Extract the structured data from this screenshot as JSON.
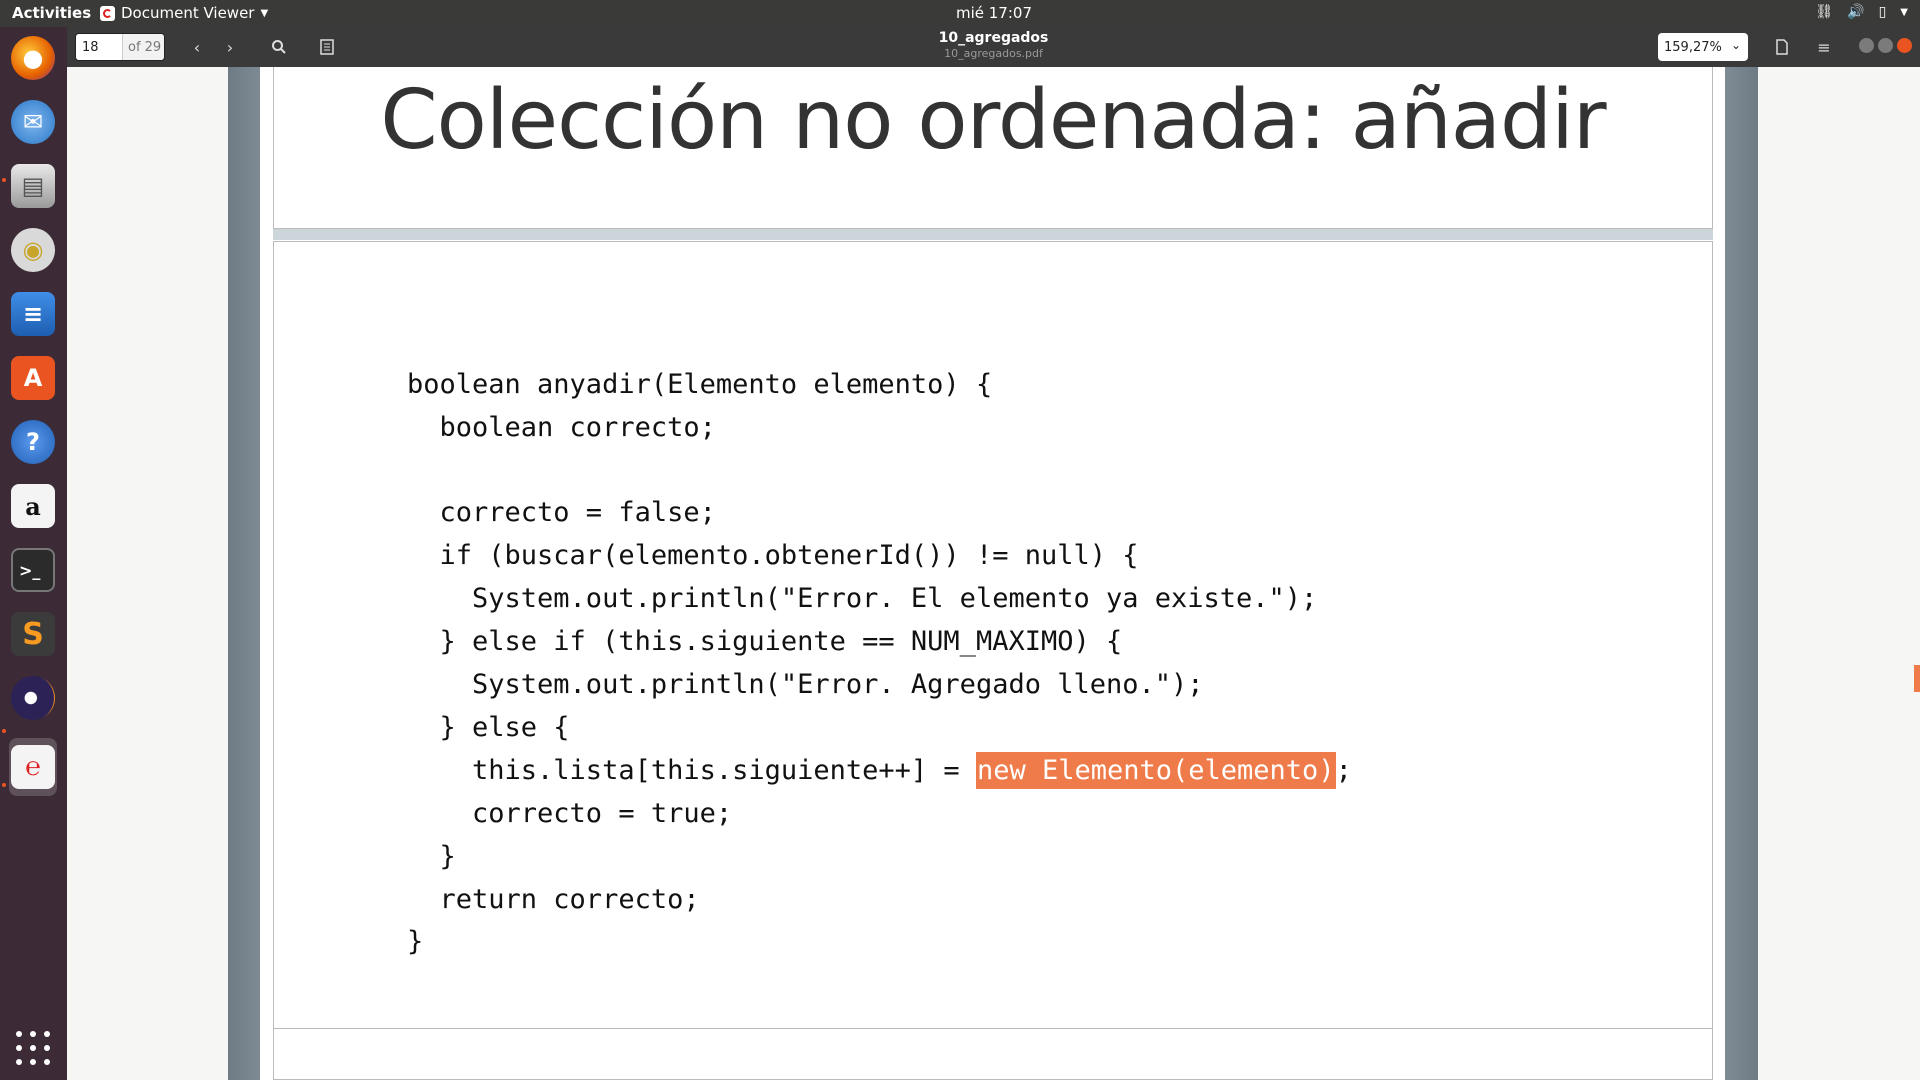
{
  "topbar": {
    "activities": "Activities",
    "app_name": "Document Viewer",
    "clock": "mié 17:07"
  },
  "dock": {
    "apps": [
      {
        "name": "firefox-icon",
        "color": "#e66000"
      },
      {
        "name": "thunderbird-icon",
        "color": "#2a78c8"
      },
      {
        "name": "files-icon",
        "color": "#8a8a8a"
      },
      {
        "name": "rhythmbox-icon",
        "color": "#c8a428"
      },
      {
        "name": "writer-icon",
        "color": "#2a6ec4"
      },
      {
        "name": "software-icon",
        "color": "#e95420"
      },
      {
        "name": "help-icon",
        "color": "#3a7ad0"
      },
      {
        "name": "amazon-icon",
        "color": "#f4f4f4"
      },
      {
        "name": "terminal-icon",
        "color": "#2b2b2b"
      },
      {
        "name": "sublime-icon",
        "color": "#3b3b3b"
      },
      {
        "name": "eclipse-icon",
        "color": "#2c2255"
      },
      {
        "name": "document-viewer-icon",
        "color": "#f4f4f4"
      }
    ]
  },
  "headerbar": {
    "page_value": "18",
    "page_total": "of 29",
    "title": "10_agregados",
    "subtitle": "10_agregados.pdf",
    "zoom": "159,27%"
  },
  "slide": {
    "title": "Colección no ordenada: añadir",
    "code": [
      "boolean anyadir(Elemento elemento) {",
      "  boolean correcto;",
      "",
      "  correcto = false;",
      "  if (buscar(elemento.obtenerId()) != null) {",
      "    System.out.println(\"Error. El elemento ya existe.\");",
      "  } else if (this.siguiente == NUM_MAXIMO) {",
      "    System.out.println(\"Error. Agregado lleno.\");",
      "  } else {",
      "    this.lista[this.siguiente++] = ",
      "    correcto = true;",
      "  }",
      "  return correcto;",
      "}"
    ],
    "highlight": "new Elemento(elemento)",
    "after_highlight": ";",
    "highlight_color": "#ee7b49"
  }
}
